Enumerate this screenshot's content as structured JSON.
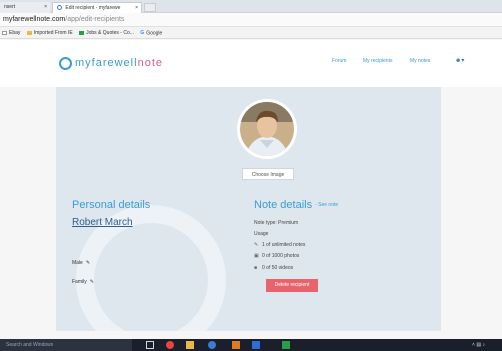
{
  "browser": {
    "tabs": [
      {
        "label": "nsert"
      },
      {
        "label": "Edit recipient - myfarewe"
      },
      {
        "label": ""
      }
    ],
    "address_host": "myfarewellnote.com",
    "address_path": "/app/edit-recipients",
    "bookmarks": [
      {
        "label": "Ebay",
        "icon": "page-icon"
      },
      {
        "label": "Imported From IE",
        "icon": "folder-icon"
      },
      {
        "label": "Jobs & Quotes - Co...",
        "icon": "green-icon"
      },
      {
        "label": "Google",
        "icon": "google-icon"
      }
    ]
  },
  "site": {
    "logo_main": "myfarewell",
    "logo_accent": "note",
    "nav": [
      "Forum",
      "My recipients",
      "My notes"
    ],
    "user_icon": "user-icon",
    "brand_color": "#3a9bd6",
    "accent_color": "#e05a8a"
  },
  "profile": {
    "choose_image_label": "Choose Image",
    "personal_details_title": "Personal details",
    "name": "Robert March",
    "fields": [
      "Male",
      "Family"
    ]
  },
  "note": {
    "title": "Note details",
    "see_note_label": "- See note",
    "note_type": "Note type: Premium",
    "usage_label": "Usage",
    "usage": [
      {
        "icon": "edit-icon",
        "text": "1 of unlimited notes"
      },
      {
        "icon": "image-icon",
        "text": "0 of 1000 photos"
      },
      {
        "icon": "video-icon",
        "text": "0 of 50 videos"
      }
    ],
    "delete_label": "Delete recipient",
    "delete_color": "#e8636b"
  },
  "taskbar": {
    "search_placeholder": "Search and Windows"
  }
}
